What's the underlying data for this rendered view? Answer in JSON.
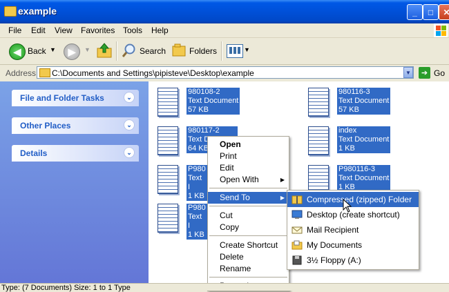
{
  "window": {
    "title": "example"
  },
  "menu": [
    "File",
    "Edit",
    "View",
    "Favorites",
    "Tools",
    "Help"
  ],
  "toolbar": {
    "back": "Back",
    "search": "Search",
    "folders": "Folders"
  },
  "address": {
    "label": "Address",
    "path": "C:\\Documents and Settings\\pipisteve\\Desktop\\example",
    "go": "Go"
  },
  "tasks": [
    {
      "title": "File and Folder Tasks"
    },
    {
      "title": "Other Places"
    },
    {
      "title": "Details"
    }
  ],
  "files": [
    {
      "name": "980108-2",
      "type": "Text Document",
      "size": "57 KB"
    },
    {
      "name": "980116-3",
      "type": "Text Document",
      "size": "57 KB"
    },
    {
      "name": "980117-2",
      "type": "Text D",
      "size": "64 KB"
    },
    {
      "name": "index",
      "type": "Text Document",
      "size": "1 KB"
    },
    {
      "name": "P980",
      "type": "Text I",
      "size": "1 KB"
    },
    {
      "name": "P980116-3",
      "type": "Text Document",
      "size": "1 KB"
    },
    {
      "name": "P980",
      "type": "Text I",
      "size": "1 KB"
    }
  ],
  "context_menu": {
    "open": "Open",
    "print": "Print",
    "edit": "Edit",
    "open_with": "Open With",
    "send_to": "Send To",
    "cut": "Cut",
    "copy": "Copy",
    "create_shortcut": "Create Shortcut",
    "delete": "Delete",
    "rename": "Rename",
    "properties": "Properties"
  },
  "send_to_menu": [
    {
      "label": "Compressed (zipped) Folder",
      "icon": "zip-folder-icon"
    },
    {
      "label": "Desktop (create shortcut)",
      "icon": "desktop-icon"
    },
    {
      "label": "Mail Recipient",
      "icon": "mail-icon"
    },
    {
      "label": "My Documents",
      "icon": "my-documents-icon"
    },
    {
      "label": "3½ Floppy (A:)",
      "icon": "floppy-icon"
    }
  ],
  "status": {
    "text": "Type: (7 Documents) Size: 1 to 1 Type"
  },
  "colors": {
    "titlebar": "#0050d8",
    "selection": "#316ac5",
    "taskpane": "#6f8ddf"
  }
}
